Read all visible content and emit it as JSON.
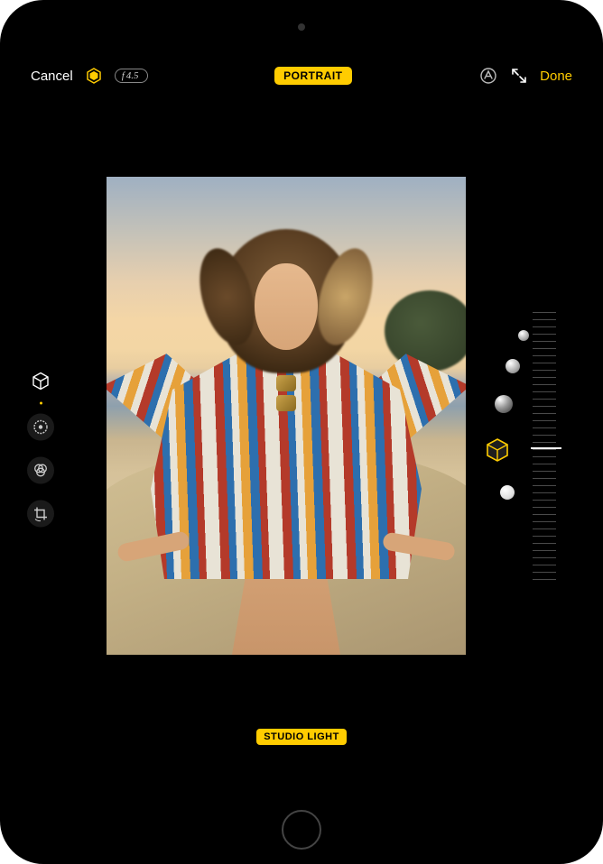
{
  "accent": "#ffcc00",
  "topbar": {
    "cancel": "Cancel",
    "done": "Done",
    "mode": "PORTRAIT",
    "fstop": "4.5",
    "fstop_prefix": "f",
    "portrait_toggle_icon": "hexagon-icon",
    "markup_icon": "markup-icon",
    "fullscreen_icon": "expand-icon"
  },
  "left_tools": [
    {
      "name": "portrait-lighting-tool",
      "icon": "cube-icon",
      "active": true
    },
    {
      "name": "adjust-tool",
      "icon": "adjust-dial-icon",
      "active": false
    },
    {
      "name": "filters-tool",
      "icon": "filters-icon",
      "active": false
    },
    {
      "name": "crop-tool",
      "icon": "crop-rotate-icon",
      "active": false
    }
  ],
  "lighting": {
    "current_label": "STUDIO LIGHT",
    "options": [
      {
        "name": "natural-light",
        "selected": false
      },
      {
        "name": "studio-light",
        "selected": true
      },
      {
        "name": "contour-light",
        "selected": false
      },
      {
        "name": "stage-light",
        "selected": false
      },
      {
        "name": "stage-light-mono",
        "selected": false
      }
    ],
    "intensity_percent": 50
  }
}
